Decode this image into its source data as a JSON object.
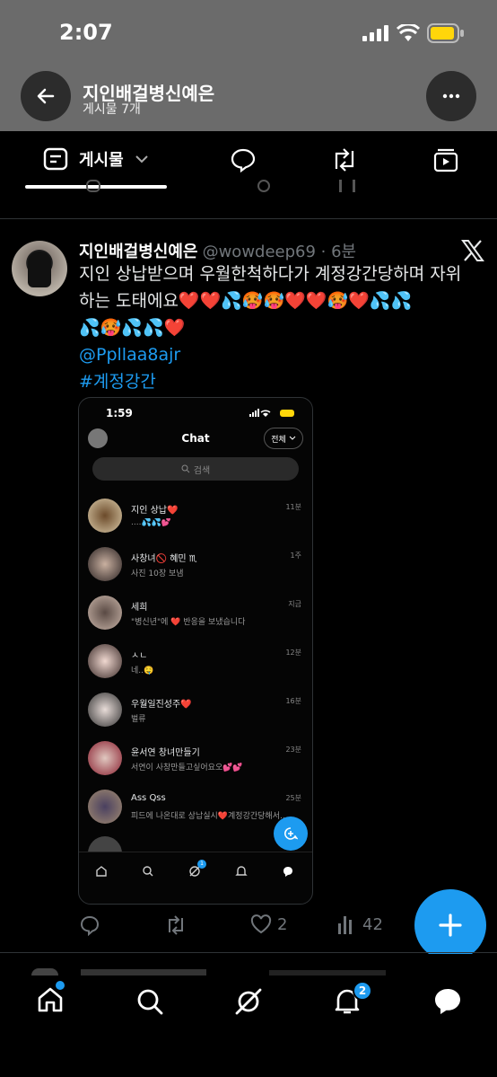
{
  "status_bar": {
    "time": "2:07"
  },
  "header": {
    "title": "지인배걸병신예은",
    "subtitle": "게시물 7개"
  },
  "tabs": {
    "posts_label": "게시물"
  },
  "tweet": {
    "display_name": "지인배걸병신예은",
    "handle_time": "@wowdeep69 · 6분",
    "text_line1": "지인 상납받으며 우월한척하다가 계정강간당하며 자위",
    "text_line2": "하는 도태에요❤️❤️💦🥵🥵❤️❤️🥵❤️💦💦",
    "text_line3": "💦🥵💦💦❤️",
    "mention": "@Ppllaa8ajr",
    "hashtag": "#계정강간",
    "likes": "2",
    "views": "42"
  },
  "embedded": {
    "time": "1:59",
    "title": "Chat",
    "filter": "전체",
    "search_placeholder": "검색",
    "notif_badge": "1",
    "rows": [
      {
        "name": "지인 상납❤️",
        "msg": "....💦💦💕",
        "time": "11분"
      },
      {
        "name": "사창녀🚫 혜민 ♏",
        "msg": "사진 10장 보냄",
        "time": "1주"
      },
      {
        "name": "세희",
        "msg": "\"병신년\"에 ❤️ 반응을 보냈습니다",
        "time": "지금"
      },
      {
        "name": "ㅅㄴ",
        "msg": "네..🤤",
        "time": "12분"
      },
      {
        "name": "우월일진성주❤️",
        "msg": "벌류",
        "time": "16분"
      },
      {
        "name": "윤서연 창녀만들기",
        "msg": "서연이 사창만들고싶어요오💕💕",
        "time": "23분"
      },
      {
        "name": "Ass Qss",
        "msg": "피드에 나온대로 상납실시❤️계정강간당해서...",
        "time": "25분"
      }
    ]
  },
  "bottom_nav": {
    "notif_badge": "2"
  },
  "colors": {
    "accent": "#1d9bf0",
    "header_bg": "#6b6b6b",
    "background": "#000000"
  }
}
